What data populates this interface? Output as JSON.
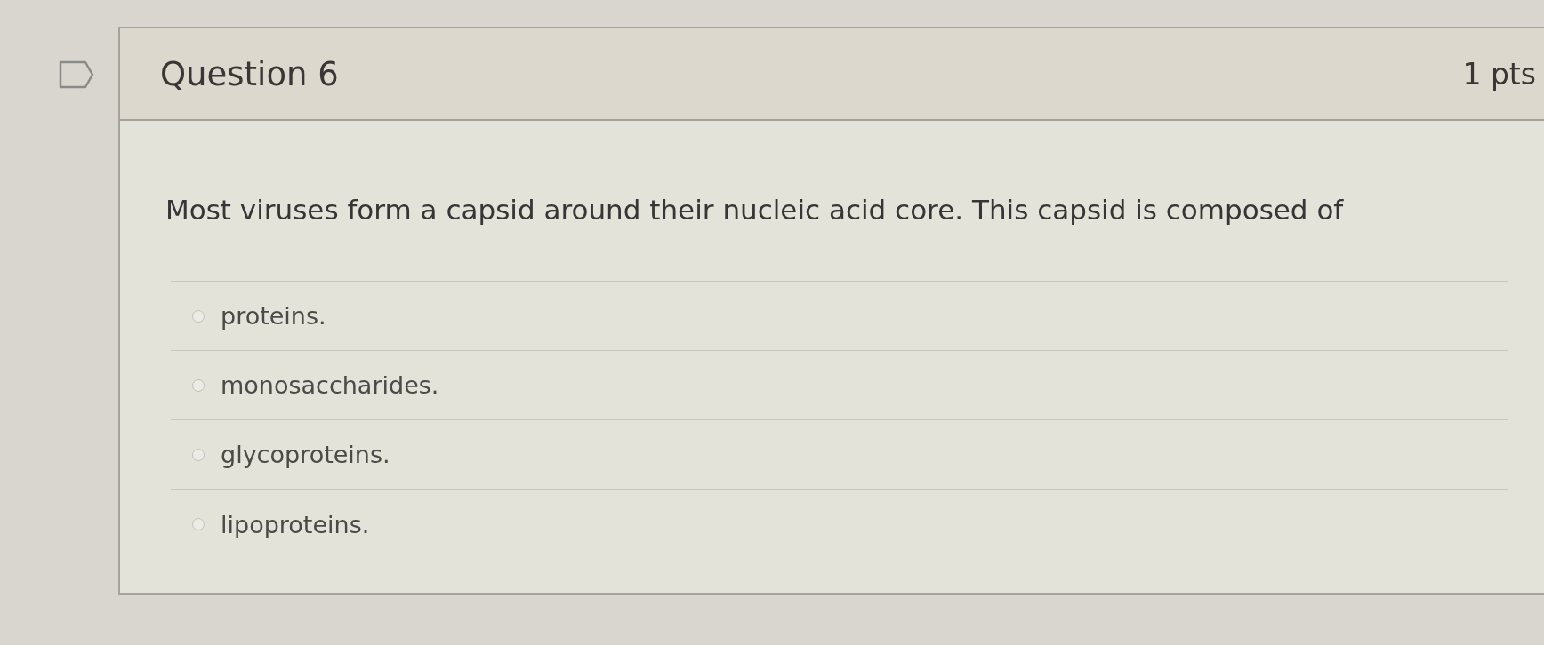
{
  "question": {
    "flagged": false,
    "title": "Question 6",
    "points": "1 pts",
    "text": "Most viruses form a capsid around their nucleic acid core. This capsid is composed of"
  },
  "answers": [
    {
      "label": "proteins.",
      "selected": false
    },
    {
      "label": "monosaccharides.",
      "selected": false
    },
    {
      "label": "glycoproteins.",
      "selected": false
    },
    {
      "label": "lipoproteins.",
      "selected": false
    }
  ]
}
